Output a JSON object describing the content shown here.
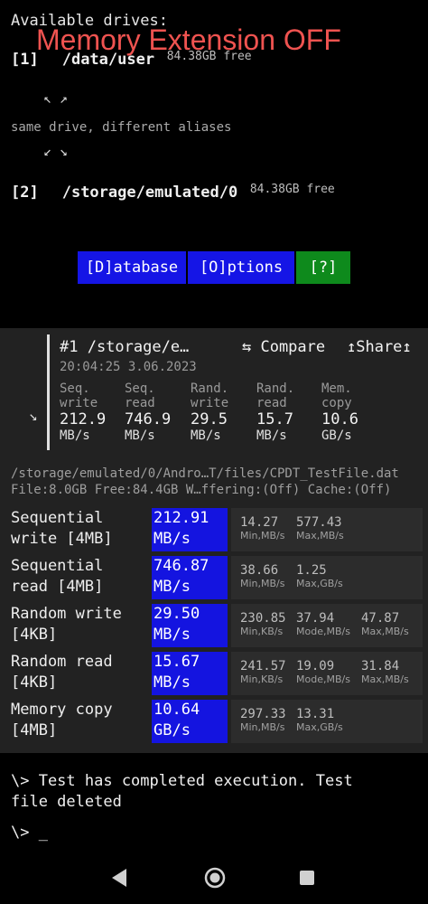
{
  "header": {
    "available_drives_label": "Available drives:",
    "overlay_title": "Memory Extension OFF"
  },
  "drives": [
    {
      "index": "[1]",
      "path": "/data/user",
      "free": "84.38GB free"
    },
    {
      "index": "[2]",
      "path": "/storage/emulated/0",
      "free": "84.38GB free"
    }
  ],
  "alias": {
    "arrows_up": "↖ ↗",
    "text": "same drive, different aliases",
    "arrows_down": "↙ ↘"
  },
  "buttons": {
    "database": "[D]atabase",
    "options": "[O]ptions",
    "help": "[?]"
  },
  "summary": {
    "title": "#1 /storage/e…",
    "compare": "⇆ Compare",
    "share": "↥Share↥",
    "datetime": "20:04:25 3.06.2023",
    "corner_arrow": "↘",
    "columns": [
      {
        "l1": "Seq.",
        "l2": "write",
        "value": "212.9",
        "unit": "MB/s"
      },
      {
        "l1": "Seq.",
        "l2": "read",
        "value": "746.9",
        "unit": "MB/s"
      },
      {
        "l1": "Rand.",
        "l2": "write",
        "value": "29.5",
        "unit": "MB/s"
      },
      {
        "l1": "Rand.",
        "l2": "read",
        "value": "15.7",
        "unit": "MB/s"
      },
      {
        "l1": "Mem.",
        "l2": "copy",
        "value": "10.6",
        "unit": "GB/s"
      }
    ]
  },
  "file_info": {
    "path": "/storage/emulated/0/Andro…T/files/CPDT_TestFile.dat",
    "details": "File:8.0GB Free:84.4GB W…ffering:(Off) Cache:(Off)"
  },
  "results": [
    {
      "l1": "Sequential",
      "l2": "write [4MB]",
      "v1": "212.91",
      "v2": "MB/s",
      "stats": [
        {
          "v": "14.27",
          "l": "Min,MB/s"
        },
        {
          "v": "577.43",
          "l": "Max,MB/s"
        }
      ]
    },
    {
      "l1": "Sequential",
      "l2": "read [4MB]",
      "v1": "746.87",
      "v2": "MB/s",
      "stats": [
        {
          "v": "38.66",
          "l": "Min,MB/s"
        },
        {
          "v": "1.25",
          "l": "Max,GB/s"
        }
      ]
    },
    {
      "l1": "Random write",
      "l2": "[4KB]",
      "v1": "29.50",
      "v2": "MB/s",
      "stats": [
        {
          "v": "230.85",
          "l": "Min,KB/s"
        },
        {
          "v": "37.94",
          "l": "Mode,MB/s"
        },
        {
          "v": "47.87",
          "l": "Max,MB/s"
        }
      ]
    },
    {
      "l1": "Random read",
      "l2": "[4KB]",
      "v1": "15.67",
      "v2": "MB/s",
      "stats": [
        {
          "v": "241.57",
          "l": "Min,KB/s"
        },
        {
          "v": "19.09",
          "l": "Mode,MB/s"
        },
        {
          "v": "31.84",
          "l": "Max,MB/s"
        }
      ]
    },
    {
      "l1": "Memory copy",
      "l2": "[4MB]",
      "v1": "10.64",
      "v2": "GB/s",
      "stats": [
        {
          "v": "297.33",
          "l": "Min,MB/s"
        },
        {
          "v": "13.31",
          "l": "Max,GB/s"
        }
      ]
    }
  ],
  "console": {
    "line1": "\\> Test has completed execution. Test",
    "line2": "file deleted",
    "prompt": "\\> _"
  },
  "navbar": {
    "back_icon": "triangle-back",
    "home_icon": "circle-home",
    "recents_icon": "square-recents"
  }
}
